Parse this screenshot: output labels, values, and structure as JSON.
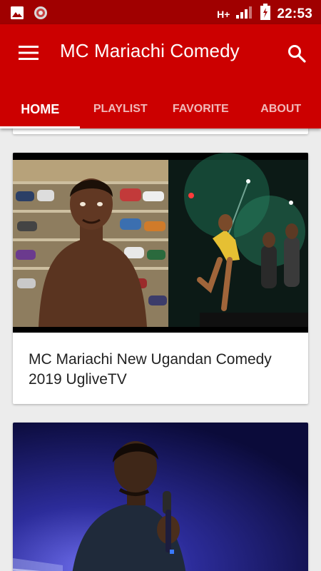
{
  "status_bar": {
    "time": "22:53",
    "network": "H+",
    "icons": [
      "image-icon",
      "notification-icon",
      "signal-icon",
      "battery-icon"
    ]
  },
  "app_bar": {
    "title": "MC Mariachi Comedy",
    "menu_icon": "hamburger-menu-icon",
    "search_icon": "search-icon",
    "color": "#cc0000"
  },
  "tabs": [
    {
      "label": "HOME",
      "active": true
    },
    {
      "label": "PLAYLIST",
      "active": false
    },
    {
      "label": "FAVORITE",
      "active": false
    },
    {
      "label": "ABOUT",
      "active": false
    }
  ],
  "videos": [
    {
      "title": "MC Mariachi New Ugandan Comedy 2019 UgliveTV"
    },
    {
      "title": ""
    }
  ]
}
